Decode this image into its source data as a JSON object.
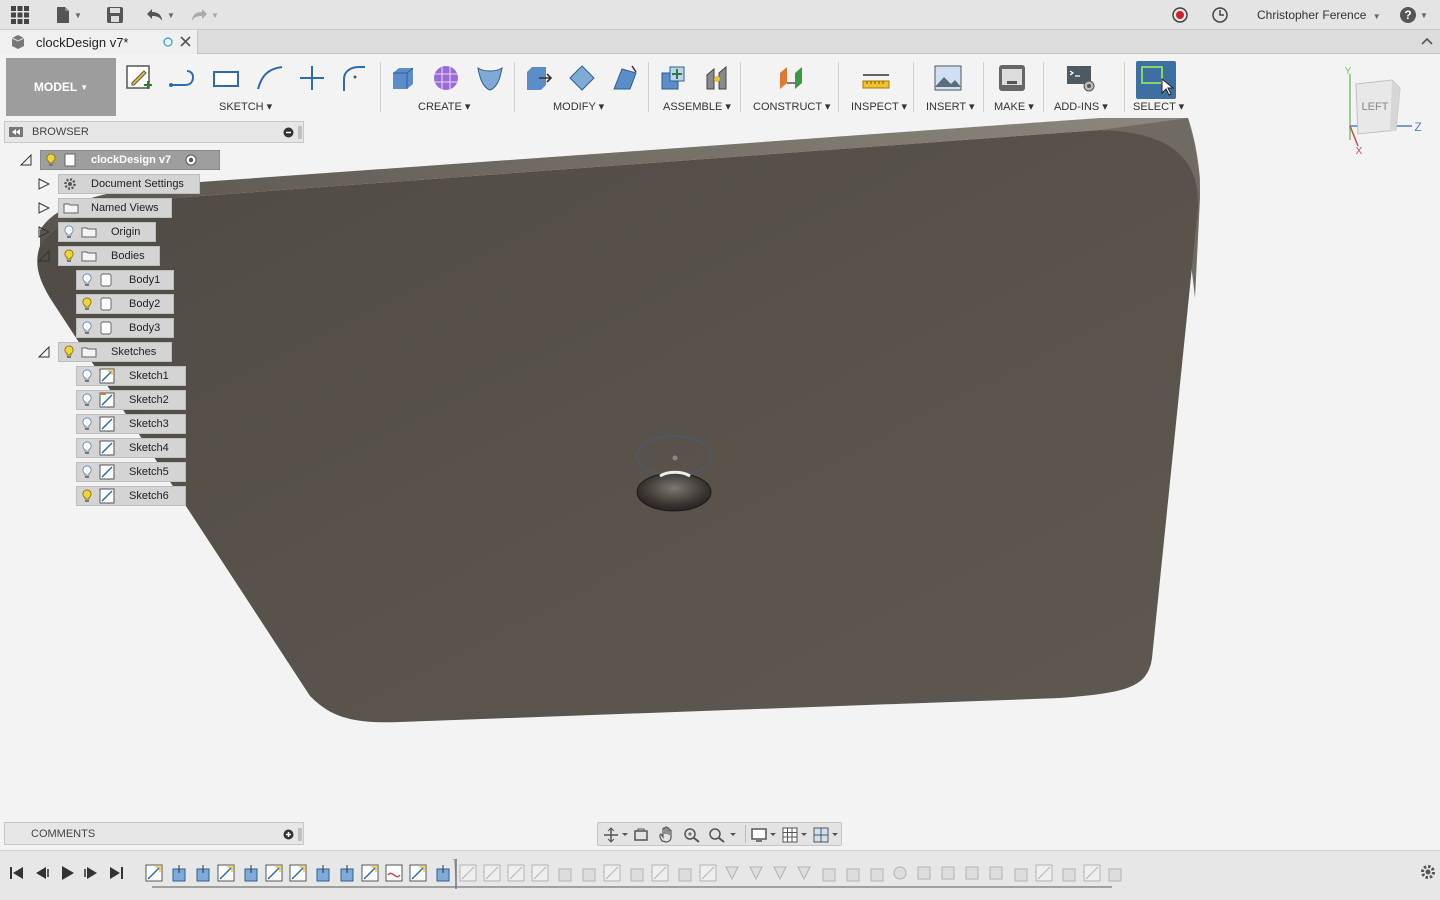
{
  "titlebar": {
    "user_name": "Christopher Ference",
    "help_label": "?"
  },
  "tab": {
    "title": "clockDesign v7*"
  },
  "toolbar": {
    "workspace": "MODEL",
    "groups": [
      {
        "label": "SKETCH"
      },
      {
        "label": "CREATE"
      },
      {
        "label": "MODIFY"
      },
      {
        "label": "ASSEMBLE"
      },
      {
        "label": "CONSTRUCT"
      },
      {
        "label": "INSPECT"
      },
      {
        "label": "INSERT"
      },
      {
        "label": "MAKE"
      },
      {
        "label": "ADD-INS"
      },
      {
        "label": "SELECT"
      }
    ]
  },
  "viewcube": {
    "face": "LEFT",
    "axis_y": "Y",
    "axis_z": "Z",
    "axis_x": "X"
  },
  "browser": {
    "title": "BROWSER",
    "root": "clockDesign v7",
    "items": [
      {
        "label": "Document Settings"
      },
      {
        "label": "Named Views"
      },
      {
        "label": "Origin"
      },
      {
        "label": "Bodies"
      },
      {
        "label": "Body1"
      },
      {
        "label": "Body2"
      },
      {
        "label": "Body3"
      },
      {
        "label": "Sketches"
      },
      {
        "label": "Sketch1"
      },
      {
        "label": "Sketch2"
      },
      {
        "label": "Sketch3"
      },
      {
        "label": "Sketch4"
      },
      {
        "label": "Sketch5"
      },
      {
        "label": "Sketch6"
      }
    ]
  },
  "comments": {
    "title": "COMMENTS"
  },
  "colors": {
    "model_body": "#58524b",
    "model_edge": "#8b857a",
    "select_active": "#3d6fa3",
    "toolbar_bg": "#f3f3f3"
  }
}
